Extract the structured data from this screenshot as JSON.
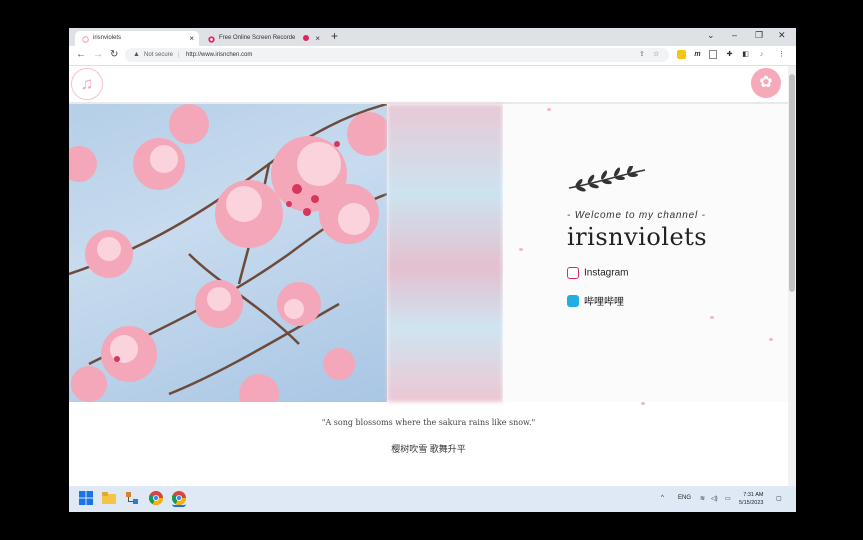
{
  "browser": {
    "tabs": [
      {
        "title": "irisnviolets",
        "close": "×",
        "active": true
      },
      {
        "title": "Free Online Screen Recorde",
        "close": "×",
        "active": false
      }
    ],
    "new_tab": "+",
    "window_controls": [
      "⌄",
      "–",
      "❐",
      "✕"
    ],
    "nav": {
      "back": "←",
      "forward": "→",
      "reload": "↻"
    },
    "omnibox": {
      "security_label": "Not secure",
      "separator": "|",
      "url": "http://www.irisnchen.com"
    },
    "extension_icons": [
      "share-icon",
      "star-icon",
      "extension-icon",
      "puzzle-icon",
      "sidebar-icon",
      "profile-icon",
      "menu-icon"
    ]
  },
  "page": {
    "welcome": "- Welcome to my channel -",
    "channel_name": "irisnviolets",
    "socials": [
      {
        "label": "Instagram",
        "icon": "instagram-icon",
        "color": "#d62976"
      },
      {
        "label": "哔哩哔哩",
        "icon": "bilibili-icon",
        "color": "#23ade5"
      }
    ],
    "quote": "\"A song blossoms where the sakura rains like snow.\"",
    "quote_cn": "樱树吹雪 歌舞升平",
    "accent": "#f6a9b8"
  },
  "taskbar": {
    "apps": [
      "windows-start-icon",
      "file-explorer-icon",
      "network-app-icon",
      "chrome-icon",
      "chrome-profile-icon"
    ],
    "tray": {
      "chevron": "^",
      "lang": "ENG"
    },
    "time": "7:31 AM",
    "date": "5/15/2023"
  }
}
